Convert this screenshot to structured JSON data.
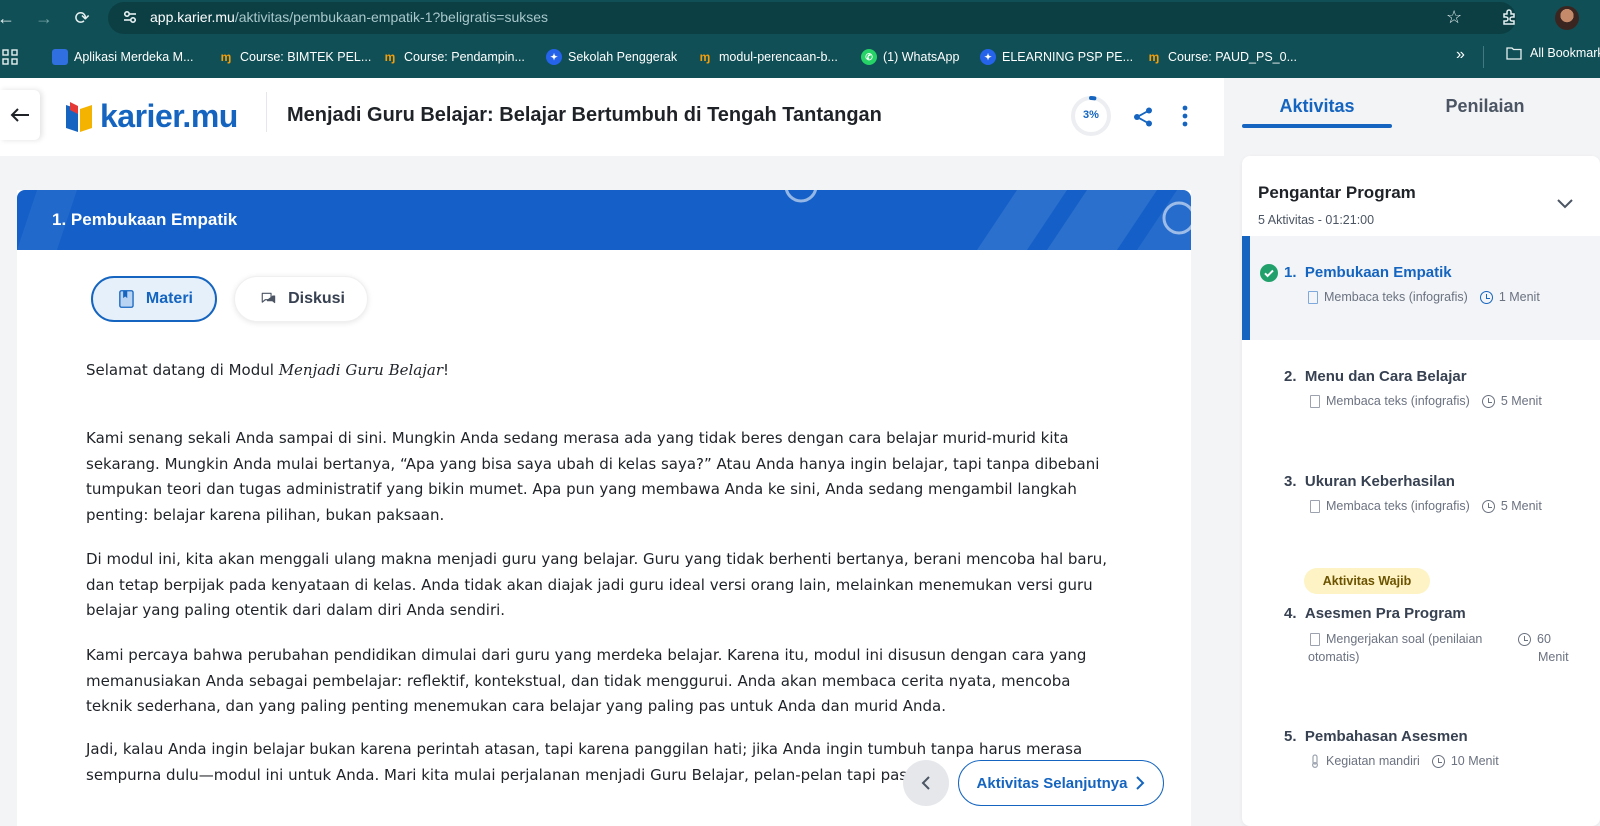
{
  "browser": {
    "url_host": "app.karier.mu",
    "url_path": "/aktivitas/pembukaan-empatik-1?beligratis=sukses",
    "bookmarks": [
      {
        "label": "Aplikasi Merdeka M...",
        "icon": "file-icon"
      },
      {
        "label": "Course: BIMTEK PEL...",
        "icon": "karier-icon"
      },
      {
        "label": "Course: Pendampin...",
        "icon": "karier-icon"
      },
      {
        "label": "Sekolah Penggerak",
        "icon": "kemendikbud-icon"
      },
      {
        "label": "modul-perencaan-b...",
        "icon": "karier-icon"
      },
      {
        "label": "(1) WhatsApp",
        "icon": "whatsapp-icon"
      },
      {
        "label": "ELEARNING PSP PE...",
        "icon": "kemendikbud-icon"
      },
      {
        "label": "Course: PAUD_PS_0...",
        "icon": "karier-icon"
      }
    ],
    "bookmarks_more": "»",
    "all_bookmarks": "All Bookmarks"
  },
  "header": {
    "logo": "karier.mu",
    "title": "Menjadi Guru Belajar: Belajar Bertumbuh di Tengah Tantangan",
    "progress_label": "3%",
    "progress_value": 0.03
  },
  "tabs": {
    "aktivitas": "Aktivitas",
    "penilaian": "Penilaian"
  },
  "lesson": {
    "banner_title": "1. Pembukaan Empatik",
    "tab_materi": "Materi",
    "tab_diskusi": "Diskusi",
    "greeting_pre": "Selamat datang di Modul ",
    "greeting_em": "Menjadi Guru Belajar",
    "greeting_post": "!",
    "paragraphs": [
      "Kami senang sekali Anda sampai di sini. Mungkin Anda sedang merasa ada yang tidak beres dengan cara belajar murid-murid kita sekarang. Mungkin Anda mulai bertanya, “Apa yang bisa saya ubah di kelas saya?” Atau Anda hanya ingin belajar, tapi tanpa dibebani tumpukan teori dan tugas administratif yang bikin mumet. Apa pun yang membawa Anda ke sini, Anda sedang mengambil langkah penting: belajar karena pilihan, bukan paksaan.",
      "Di modul ini, kita akan menggali ulang makna menjadi guru yang belajar. Guru yang tidak berhenti bertanya, berani mencoba hal baru, dan tetap berpijak pada kenyataan di kelas. Anda tidak akan diajak jadi guru ideal versi orang lain, melainkan menemukan versi guru belajar yang paling otentik dari dalam diri Anda sendiri.",
      "Kami percaya bahwa perubahan pendidikan dimulai dari guru yang merdeka belajar. Karena itu, modul ini disusun dengan cara yang memanusiakan Anda sebagai pembelajar: reflektif, kontekstual, dan tidak menggurui. Anda akan membaca cerita nyata, mencoba teknik sederhana, dan yang paling penting menemukan cara belajar yang paling pas untuk Anda dan murid Anda.",
      "Jadi, kalau Anda ingin belajar bukan karena perintah atasan, tapi karena panggilan hati; jika Anda ingin tumbuh tanpa harus merasa sempurna dulu—modul ini untuk Anda. Mari kita mulai perjalanan menjadi Guru Belajar, pelan-pelan tapi pas"
    ],
    "next_button": "Aktivitas Selanjutnya"
  },
  "sidebar": {
    "section_title": "Pengantar Program",
    "section_count": "5 Aktivitas",
    "section_sep": "-",
    "section_duration": "01:21:00",
    "badge_wajib": "Aktivitas Wajib",
    "activities": [
      {
        "num": "1.",
        "title": "Pembukaan Empatik",
        "type": "Membaca teks (infografis)",
        "time": "1 Menit"
      },
      {
        "num": "2.",
        "title": "Menu dan Cara Belajar",
        "type": "Membaca teks (infografis)",
        "time": "5 Menit"
      },
      {
        "num": "3.",
        "title": "Ukuran Keberhasilan",
        "type": "Membaca teks (infografis)",
        "time": "5 Menit"
      },
      {
        "num": "4.",
        "title": "Asesmen Pra Program",
        "type_line1": "Mengerjakan soal (penilaian",
        "type_line2": "otomatis)",
        "time_line1": "60",
        "time_line2": "Menit"
      },
      {
        "num": "5.",
        "title": "Pembahasan Asesmen",
        "type": "Kegiatan mandiri",
        "time": "10 Menit"
      }
    ]
  },
  "colors": {
    "primary": "#1565c0",
    "browser_bar": "#0f4f55",
    "success": "#22a06b",
    "badge_bg": "#fdf3c4"
  }
}
